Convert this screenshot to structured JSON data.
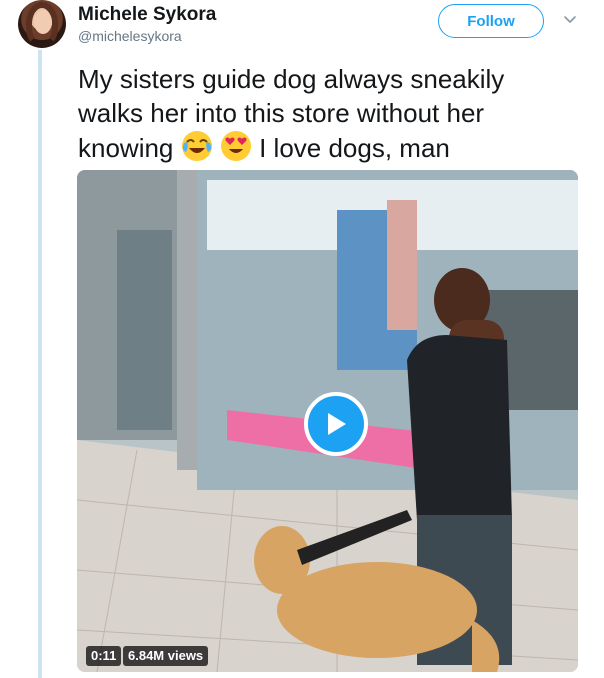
{
  "user": {
    "name": "Michele Sykora",
    "handle": "@michelesykora"
  },
  "follow_label": "Follow",
  "tweet": {
    "text_line1": "My sisters guide dog always sneakily",
    "text_line2": "walks her into this store without her",
    "text_line3_a": "knowing",
    "text_line3_b": "I love dogs, man",
    "emojis": [
      "face-with-tears-of-joy-icon",
      "smiling-face-with-heart-eyes-icon"
    ]
  },
  "video": {
    "duration": "0:11",
    "views": "6.84M views"
  },
  "colors": {
    "accent": "#1da1f2",
    "text": "#14171a",
    "secondary": "#657786"
  }
}
